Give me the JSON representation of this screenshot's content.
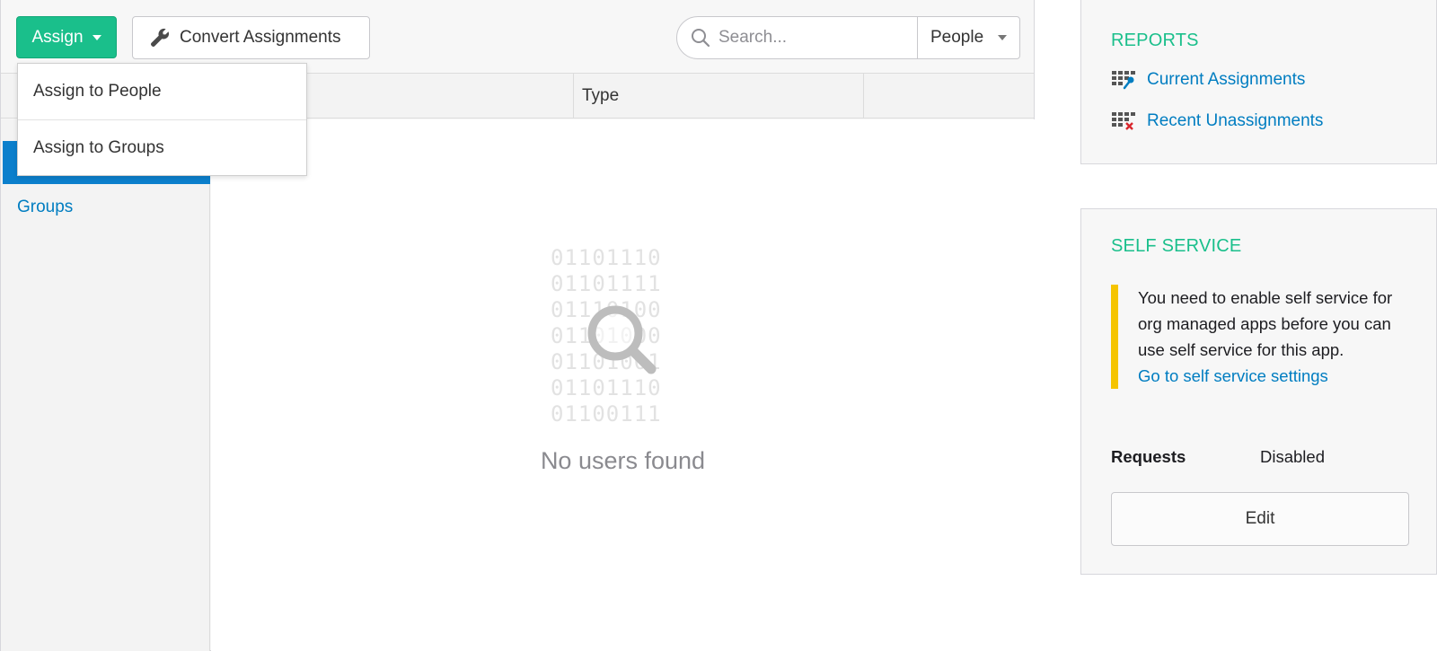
{
  "toolbar": {
    "assign_label": "Assign",
    "convert_label": "Convert Assignments",
    "search_placeholder": "Search...",
    "filter_selected": "People"
  },
  "dropdown": {
    "items": [
      {
        "label": "Assign to People"
      },
      {
        "label": "Assign to Groups"
      }
    ]
  },
  "table": {
    "columns": [
      "",
      "Type",
      ""
    ]
  },
  "side_nav": {
    "items": [
      {
        "label": "",
        "active": true
      },
      {
        "label": "Groups",
        "active": false
      }
    ]
  },
  "empty_state": {
    "binary_lines": [
      "01101110",
      "01101111",
      "01110100",
      "01101000",
      "01101001",
      "01101110",
      "01100111"
    ],
    "message": "No users found"
  },
  "reports": {
    "title": "REPORTS",
    "links": [
      {
        "label": "Current Assignments",
        "icon": "grid-key-icon"
      },
      {
        "label": "Recent Unassignments",
        "icon": "grid-x-icon"
      }
    ]
  },
  "self_service": {
    "title": "SELF SERVICE",
    "notice": "You need to enable self service for org managed apps before you can use self service for this app.",
    "notice_link": "Go to self service settings",
    "requests_label": "Requests",
    "requests_value": "Disabled",
    "edit_label": "Edit"
  },
  "colors": {
    "accent_green": "#1abf8b",
    "link_blue": "#007dc1",
    "active_nav_blue": "#0b7fcc",
    "warning_yellow": "#f5c400"
  }
}
